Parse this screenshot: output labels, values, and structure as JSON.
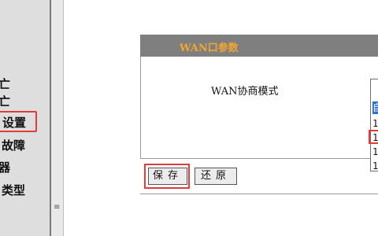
{
  "sidebar": {
    "items": [
      {
        "label": "亡"
      },
      {
        "label": "亡"
      },
      {
        "label": "设置"
      },
      {
        "label": "故障"
      },
      {
        "label": "器"
      },
      {
        "label": "类型"
      }
    ]
  },
  "panel": {
    "title": "WAN口参数",
    "field_label": "WAN协商模式",
    "options": [
      "自",
      "1",
      "1",
      "1",
      "1"
    ]
  },
  "buttons": {
    "save": "保存",
    "restore": "还原"
  },
  "colors": {
    "title_bar": "#7f7f7f",
    "title_text": "#f3a531",
    "highlight": "#e23b3b",
    "selected_option": "#2b6fd1"
  }
}
